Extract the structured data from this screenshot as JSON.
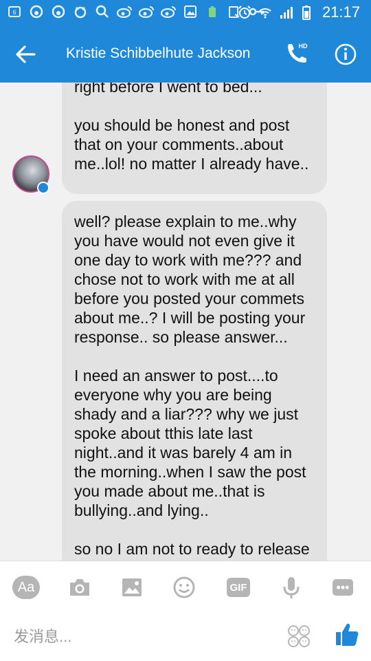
{
  "status_bar": {
    "time": "21:17",
    "left_icons": [
      "notification-6-icon",
      "swirl-app-icon",
      "swirl-app-icon",
      "sync-icon",
      "search-icon",
      "weibo-icon",
      "weibo-icon",
      "weibo-icon",
      "image-icon",
      "battery-saver-icon",
      "clipboard-icon",
      "key-icon"
    ],
    "right_icons": [
      "alarm-icon",
      "wifi-icon",
      "signal-icon",
      "battery-icon"
    ]
  },
  "header": {
    "title": "Kristie Schibbelhute Jackson",
    "back_icon": "back-arrow-icon",
    "call_icon": "hd-call-icon",
    "call_badge": "HD",
    "info_icon": "info-icon"
  },
  "messages": [
    {
      "text": "right before I went to bed...\n\nyou should be honest and post that on your comments..about me..lol! no matter I already have..",
      "sender": "other"
    },
    {
      "text": "well? please explain to me..why you have would not even give it one day to work with me??? and chose not to work with me at all before you posted your commets about me..? I will be posting your response.. so please answer...\n\nI need an answer to post....to everyone why you are being shady and a liar??? why we just spoke about tthis late last night..and it was barely 4 am in the morning..when I saw the post you made about me..that is bullying..and lying..\n\nso no I am not to ready to release",
      "sender": "other"
    }
  ],
  "composer": {
    "aa_label": "Aa",
    "gif_label": "GIF",
    "more_label": "•••",
    "placeholder": "发消息...",
    "tools": [
      "text-style-icon",
      "camera-icon",
      "gallery-icon",
      "emoji-icon",
      "gif-icon",
      "microphone-icon",
      "more-icon"
    ],
    "like_icon": "thumbs-up-icon"
  },
  "colors": {
    "brand": "#1f88d9",
    "bubble": "#e2e2e2",
    "tool_gray": "#b5b5b5"
  }
}
